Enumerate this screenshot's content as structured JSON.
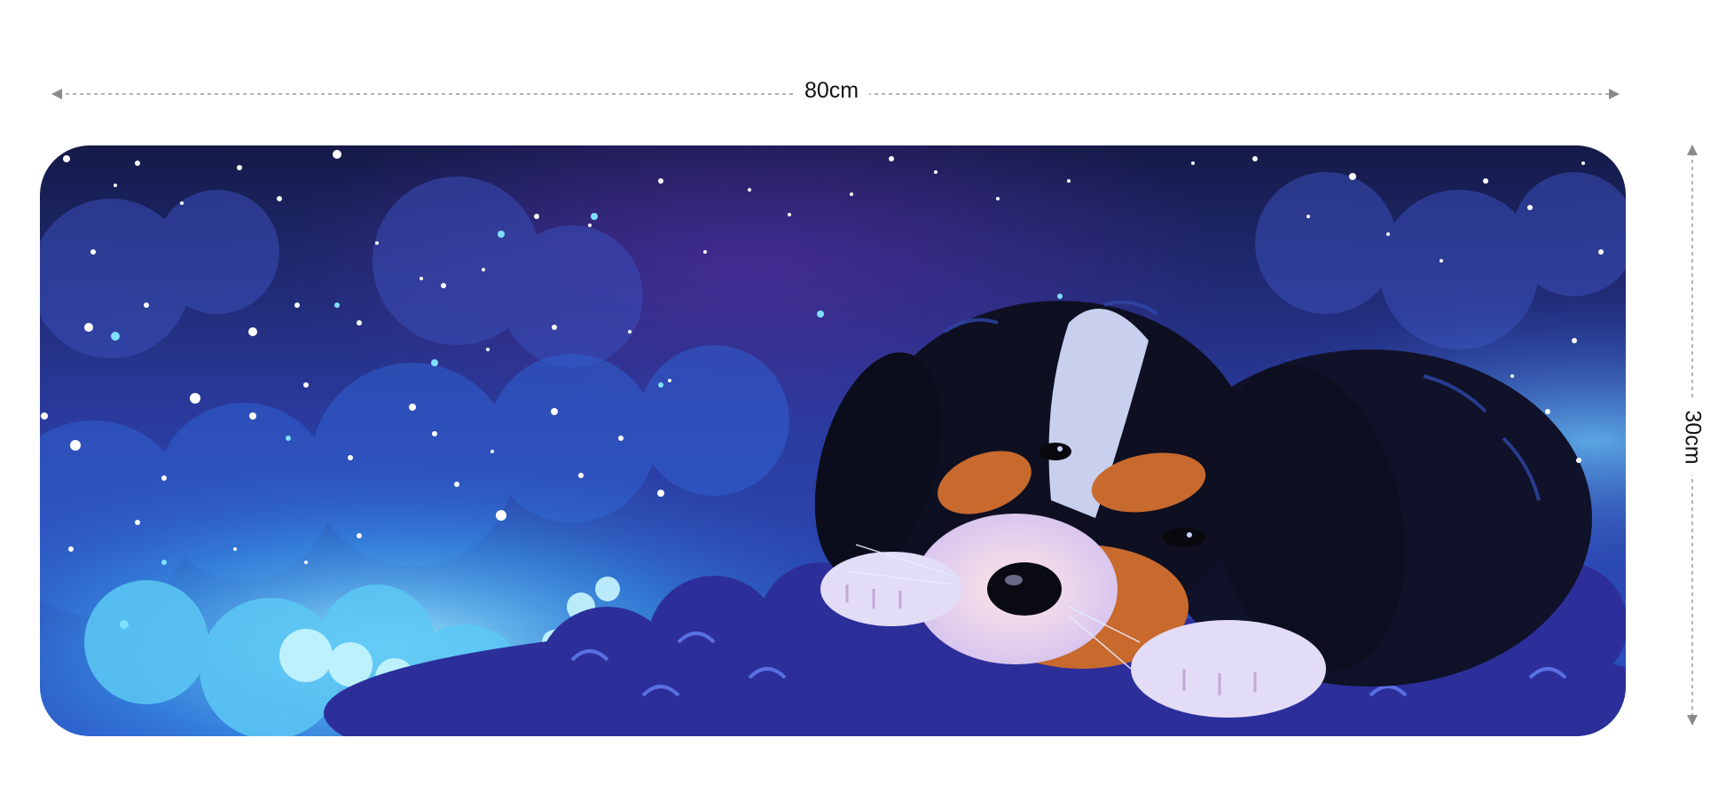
{
  "product": {
    "image_subject": "sleeping-puppy-night-sky",
    "colors": {
      "sky_dark": "#141a4a",
      "sky_mid": "#253a9a",
      "glow": "#7fe0ff",
      "fur_black": "#0e1022",
      "fur_tan": "#c8692e",
      "fur_white": "#eef0ff"
    }
  },
  "dimensions": {
    "width_label": "80cm",
    "height_label": "30cm"
  }
}
